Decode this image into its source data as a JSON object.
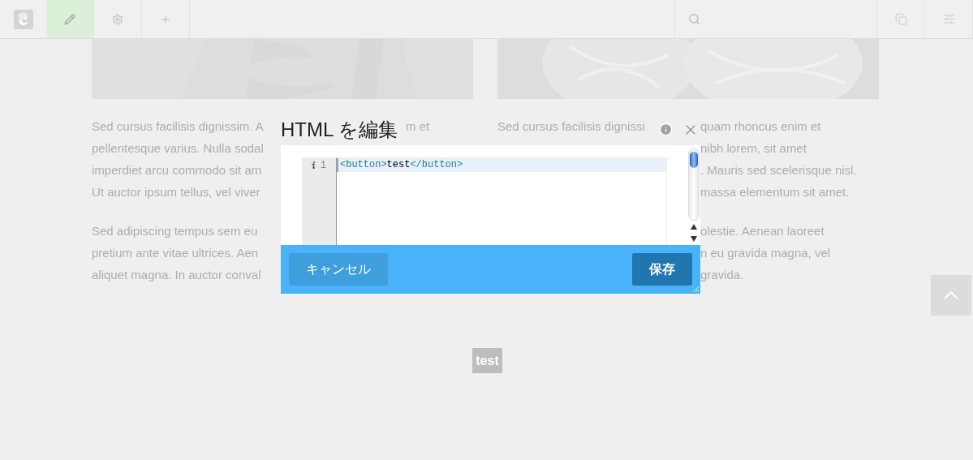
{
  "toolbar": {
    "items": [
      {
        "kind": "logo"
      },
      {
        "kind": "edit",
        "selected": true
      },
      {
        "kind": "settings",
        "selected": false
      },
      {
        "kind": "add",
        "selected": false
      }
    ],
    "right_items": [
      {
        "kind": "search"
      },
      {
        "kind": "copy"
      },
      {
        "kind": "sliders"
      }
    ]
  },
  "columns": [
    {
      "picture": {
        "kind": "picture"
      },
      "paragraphs": [
        [
          {
            "kind": "head",
            "text": "Sed cursus facilisis dignissim. A",
            "tail": "m et"
          },
          {
            "kind": "head",
            "text": "pellentesque varius. Nulla sodal"
          },
          {
            "kind": "head",
            "text": "imperdiet arcu commodo sit am"
          },
          {
            "kind": "head",
            "text": "Ut auctor ipsum tellus, vel viver"
          }
        ],
        [
          {
            "kind": "head",
            "text": "Sed adipiscing tempus sem eu"
          },
          {
            "kind": "head",
            "text": "pretium ante vitae ultrices. Aen"
          },
          {
            "kind": "head",
            "text": "aliquet magna. In auctor conval"
          }
        ]
      ]
    },
    {
      "picture": {
        "kind": "picture"
      },
      "paragraphs": [
        [
          {
            "kind": "head",
            "text": "Sed cursus facilisis dignissi",
            "tail": "quam rhoncus enim et"
          },
          {
            "kind": "tail",
            "tail": "nibh lorem, sit amet"
          },
          {
            "kind": "tail",
            "tail": ". Mauris sed scelerisque nisl."
          },
          {
            "kind": "tail",
            "tail": "massa elementum sit amet."
          }
        ],
        [
          {
            "kind": "tail",
            "tail": "olestie. Aenean laoreet"
          },
          {
            "kind": "tail",
            "tail": "n eu gravida magna, vel"
          },
          {
            "kind": "tail",
            "tail": "gravida."
          }
        ]
      ]
    }
  ],
  "page_button": "test",
  "modal": {
    "title": "HTML を編集",
    "editor": {
      "lines": [
        {
          "number": "1",
          "active": true,
          "tokens": [
            {
              "kind": "tag",
              "text": "<button>"
            },
            {
              "kind": "text",
              "text": "test"
            },
            {
              "kind": "tag",
              "text": "</button>"
            }
          ]
        }
      ]
    },
    "buttons": [
      {
        "kind": "cancel",
        "label": "キャンセル"
      },
      {
        "kind": "save",
        "label": "保存"
      }
    ]
  }
}
